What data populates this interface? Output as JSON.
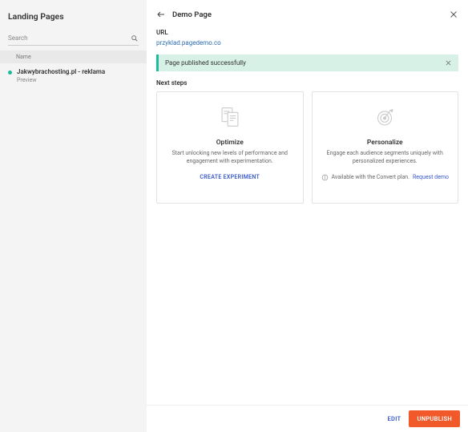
{
  "left": {
    "title": "Landing Pages",
    "search_placeholder": "Search",
    "name_header": "Name",
    "items": [
      {
        "title": "Jakwybrachosting.pl - reklama",
        "subtitle": "Preview"
      }
    ]
  },
  "detail": {
    "title": "Demo Page",
    "url_label": "URL",
    "url_value": "przyklad.pagedemo.co",
    "banner": "Page published successfully",
    "next_steps": "Next steps",
    "cards": [
      {
        "title": "Optimize",
        "desc": "Start unlocking new levels of performance and engagement with experimentation.",
        "action": "CREATE EXPERIMENT"
      },
      {
        "title": "Personalize",
        "desc": "Engage each audience segments uniquely with personalized experiences.",
        "foot_text": "Available with the Convert plan.",
        "foot_link": "Request demo"
      }
    ]
  },
  "footer": {
    "edit": "EDIT",
    "unpublish": "UNPUBLISH"
  }
}
